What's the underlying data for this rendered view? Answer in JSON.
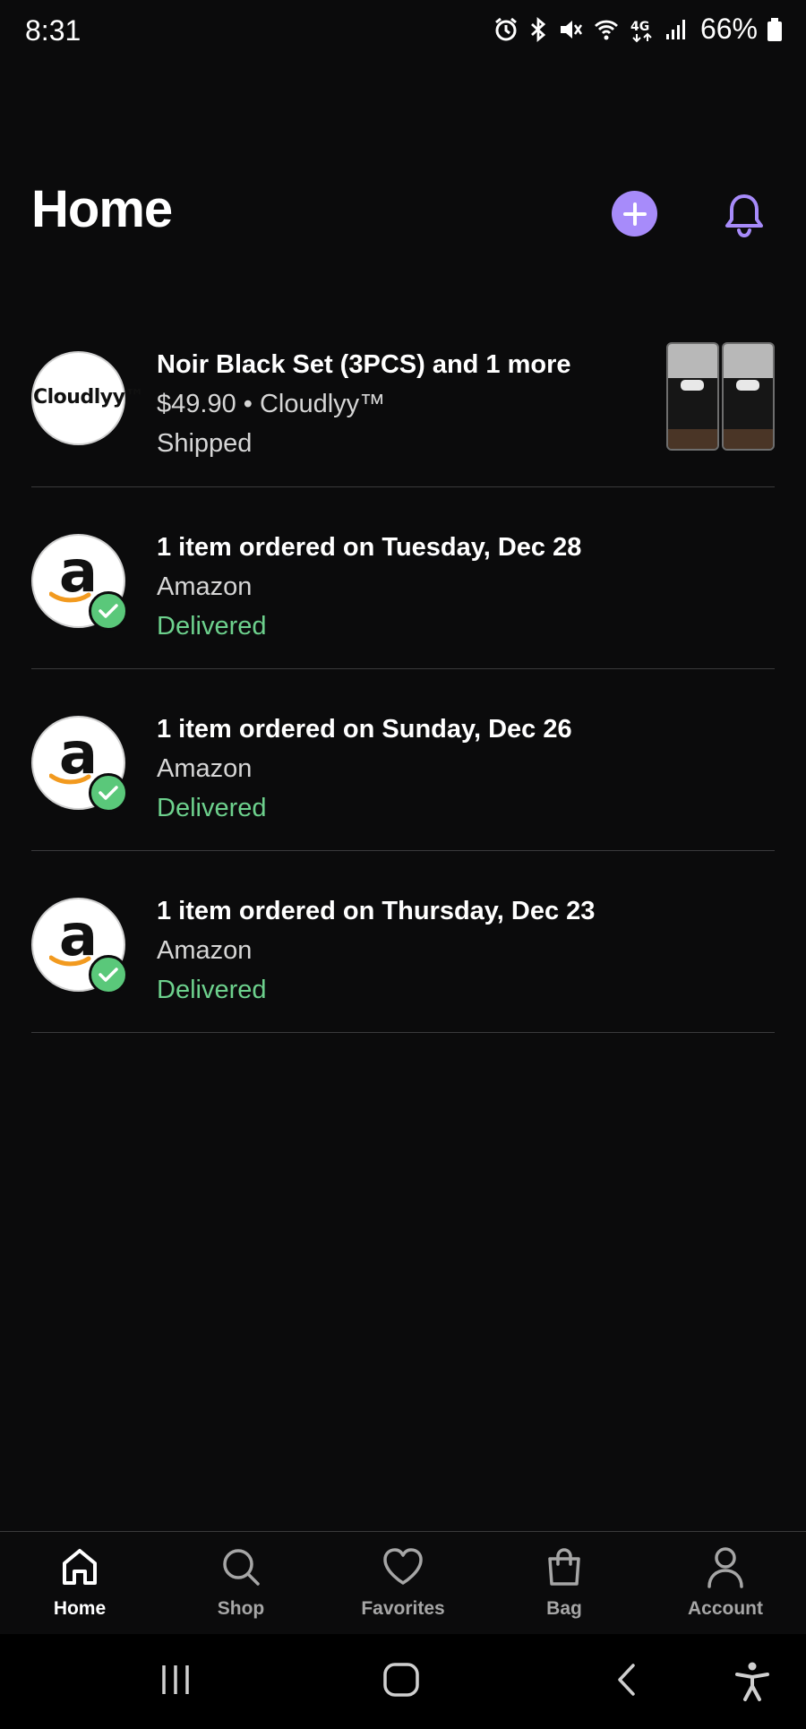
{
  "status_bar": {
    "time": "8:31",
    "battery": "66%",
    "icons": [
      "alarm-icon",
      "bluetooth-icon",
      "mute-icon",
      "wifi-icon",
      "4g-icon",
      "signal-icon",
      "battery-icon"
    ]
  },
  "header": {
    "title": "Home"
  },
  "colors": {
    "accent": "#a78bfa",
    "delivered": "#6dd18d",
    "background": "#0b0b0c",
    "divider": "#3a3a3c"
  },
  "orders": [
    {
      "merchant_logo": "Cloudlyy™",
      "title": "Noir Black Set (3PCS) and 1 more",
      "subtitle": "$49.90 • Cloudlyy™",
      "status": "Shipped"
    },
    {
      "merchant_logo": "a",
      "title": "1 item ordered on Tuesday, Dec 28",
      "subtitle": "Amazon",
      "status": "Delivered"
    },
    {
      "merchant_logo": "a",
      "title": "1 item ordered on Sunday, Dec 26",
      "subtitle": "Amazon",
      "status": "Delivered"
    },
    {
      "merchant_logo": "a",
      "title": "1 item ordered on Thursday, Dec 23",
      "subtitle": "Amazon",
      "status": "Delivered"
    }
  ],
  "bottom_nav": {
    "items": [
      {
        "label": "Home",
        "icon": "home-icon",
        "active": true
      },
      {
        "label": "Shop",
        "icon": "search-icon",
        "active": false
      },
      {
        "label": "Favorites",
        "icon": "heart-icon",
        "active": false
      },
      {
        "label": "Bag",
        "icon": "bag-icon",
        "active": false
      },
      {
        "label": "Account",
        "icon": "person-icon",
        "active": false
      }
    ]
  },
  "system_nav": [
    "recents-icon",
    "home-circle-icon",
    "back-icon",
    "accessibility-icon"
  ]
}
